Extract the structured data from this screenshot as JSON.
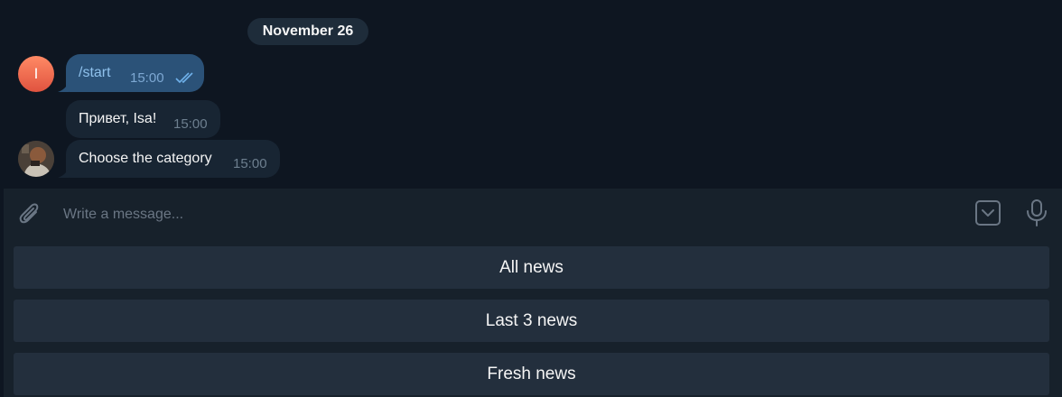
{
  "chat": {
    "date": "November 26",
    "user_avatar_letter": "I",
    "messages": [
      {
        "text": "/start",
        "time": "15:00"
      },
      {
        "text": "Привет, Isa!",
        "time": "15:00"
      },
      {
        "text": "Choose the category",
        "time": "15:00"
      }
    ]
  },
  "composer": {
    "placeholder": "Write a message...",
    "icons": [
      "paperclip-icon",
      "keyboard-toggle-icon",
      "microphone-icon"
    ]
  },
  "keyboard": {
    "buttons": [
      "All news",
      "Last 3 news",
      "Fresh news"
    ]
  },
  "colors": {
    "background": "#0e1621",
    "outgoing_bubble": "#2b5278",
    "incoming_bubble": "#182533",
    "panel": "#17212b",
    "keyboard_button": "#232f3d"
  }
}
